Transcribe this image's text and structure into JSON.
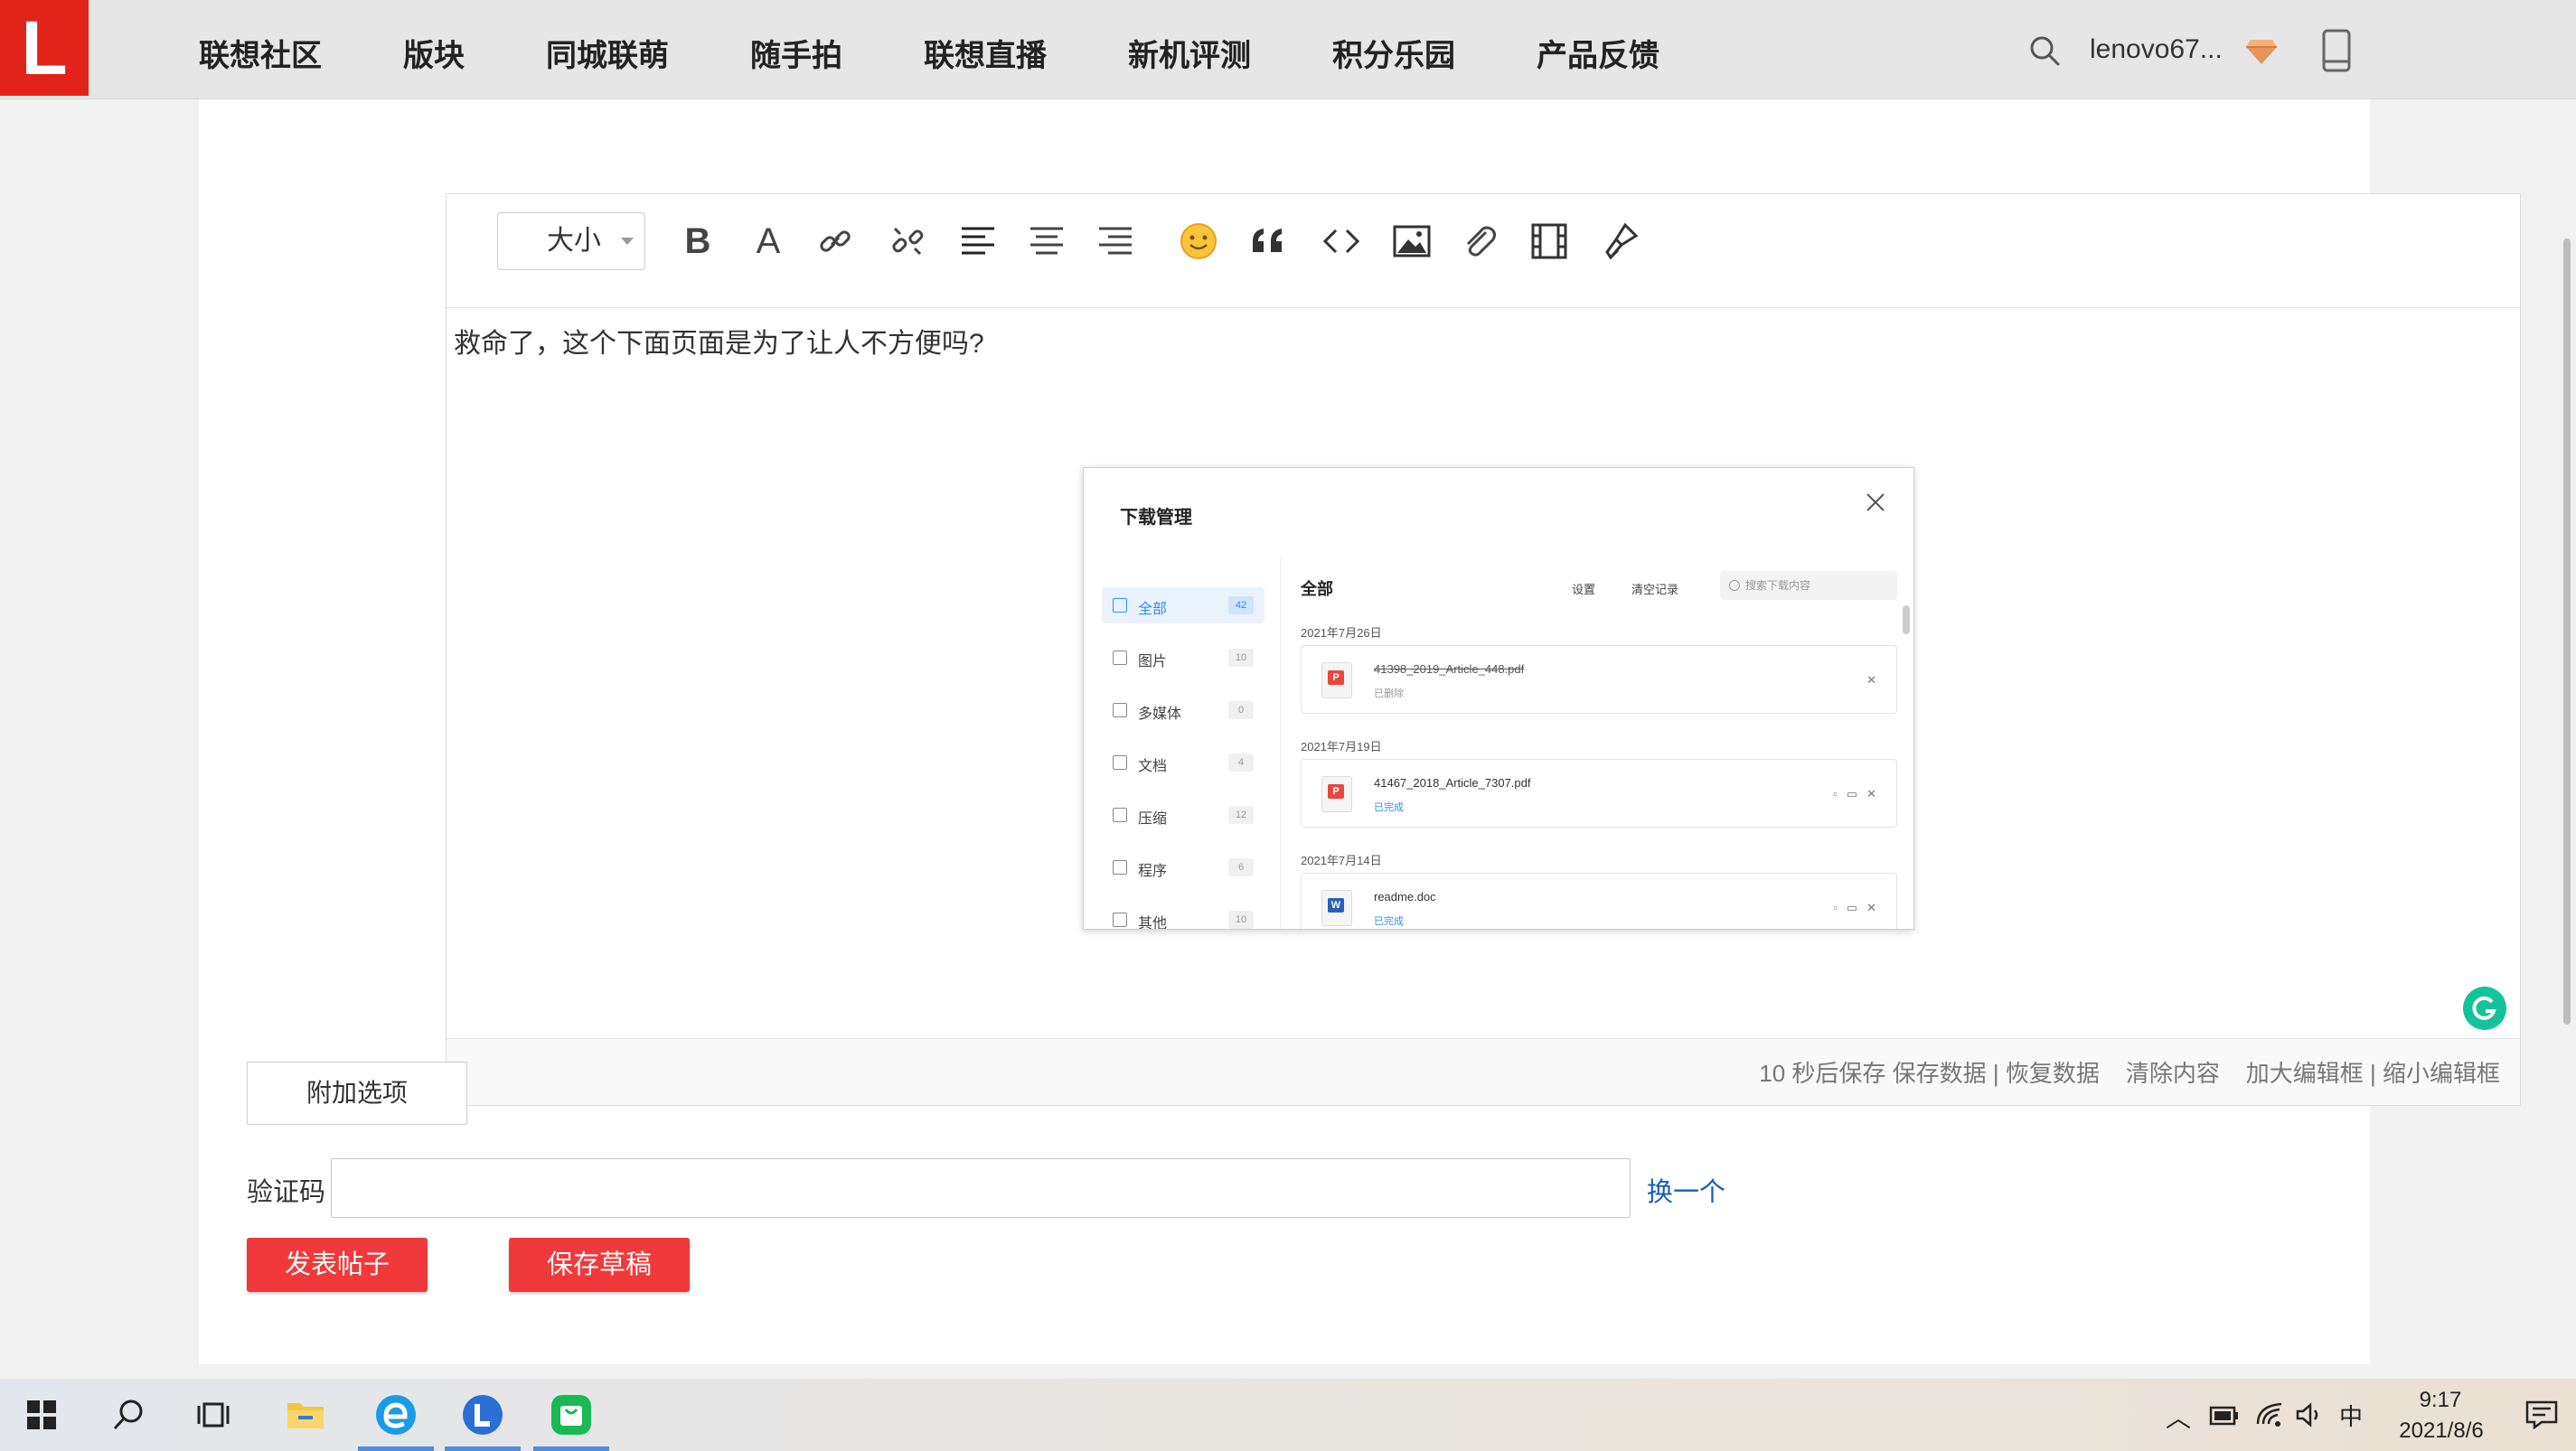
{
  "nav": {
    "logo": "L",
    "items": [
      "联想社区",
      "版块",
      "同城联萌",
      "随手拍",
      "联想直播",
      "新机评测",
      "积分乐园",
      "产品反馈"
    ],
    "username": "lenovo67..."
  },
  "editor": {
    "size_select": "大小",
    "toolbar_icons": [
      "bold-icon",
      "font-color-icon",
      "link-icon",
      "unlink-icon",
      "align-left-icon",
      "align-center-icon",
      "align-right-icon",
      "emoji-icon",
      "quote-icon",
      "code-icon",
      "image-icon",
      "attachment-icon",
      "video-icon",
      "clear-format-icon"
    ],
    "bold_glyph": "B",
    "font_color_glyph": "A",
    "body_text": "救命了，这个下面页面是为了让人不方便吗?",
    "footer": {
      "autosave": "10 秒后保存",
      "save": "保存数据",
      "sep1": "|",
      "restore": "恢复数据",
      "clear": "清除内容",
      "enlarge": "加大编辑框",
      "sep2": "|",
      "shrink": "缩小编辑框"
    }
  },
  "embed": {
    "title": "下载管理",
    "sidebar": [
      {
        "label": "全部",
        "count": "42",
        "active": true
      },
      {
        "label": "图片",
        "count": "10"
      },
      {
        "label": "多媒体",
        "count": "0"
      },
      {
        "label": "文档",
        "count": "4"
      },
      {
        "label": "压缩",
        "count": "12"
      },
      {
        "label": "程序",
        "count": "6"
      },
      {
        "label": "其他",
        "count": "10"
      }
    ],
    "main_title": "全部",
    "settings": "设置",
    "clear_records": "清空记录",
    "search_placeholder": "搜索下载内容",
    "groups": [
      {
        "date": "2021年7月26日",
        "file": "41398_2019_Article_448.pdf",
        "status": "已删除",
        "type": "pdf"
      },
      {
        "date": "2021年7月19日",
        "file": "41467_2018_Article_7307.pdf",
        "status": "已完成",
        "type": "pdf"
      },
      {
        "date": "2021年7月14日",
        "file": "readme.doc",
        "status": "已完成",
        "type": "doc"
      }
    ]
  },
  "form": {
    "extra_options": "附加选项",
    "captcha_label": "验证码",
    "captcha_value": "",
    "captcha_refresh": "换一个",
    "publish": "发表帖子",
    "save_draft": "保存草稿"
  },
  "taskbar": {
    "ime": "中",
    "time": "9:17",
    "date": "2021/8/6"
  },
  "colors": {
    "brand_red": "#e2231a",
    "button_red": "#f0393a",
    "link_blue": "#1a5fb4",
    "accent_blue": "#2f8ef4"
  }
}
